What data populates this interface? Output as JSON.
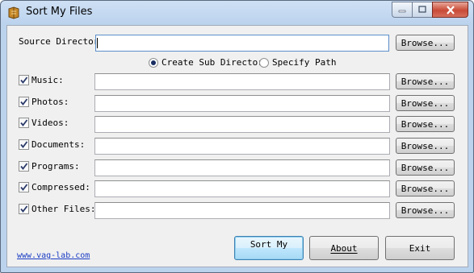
{
  "window": {
    "title": "Sort My Files"
  },
  "source": {
    "label": "Source Directory",
    "value": "",
    "browse_label": "Browse..."
  },
  "options": [
    {
      "label": "Create Sub Directori",
      "selected": true
    },
    {
      "label": "Specify Path",
      "selected": false
    }
  ],
  "categories": [
    {
      "label": "Music:",
      "checked": true,
      "value": "",
      "browse_label": "Browse..."
    },
    {
      "label": "Photos:",
      "checked": true,
      "value": "",
      "browse_label": "Browse..."
    },
    {
      "label": "Videos:",
      "checked": true,
      "value": "",
      "browse_label": "Browse..."
    },
    {
      "label": "Documents:",
      "checked": true,
      "value": "",
      "browse_label": "Browse..."
    },
    {
      "label": "Programs:",
      "checked": true,
      "value": "",
      "browse_label": "Browse..."
    },
    {
      "label": "Compressed:",
      "checked": true,
      "value": "",
      "browse_label": "Browse..."
    },
    {
      "label": "Other Files:",
      "checked": true,
      "value": "",
      "browse_label": "Browse..."
    }
  ],
  "buttons": {
    "sort": "Sort My",
    "about": "About",
    "exit": "Exit"
  },
  "footer": {
    "link": "www.vag-lab.com"
  }
}
